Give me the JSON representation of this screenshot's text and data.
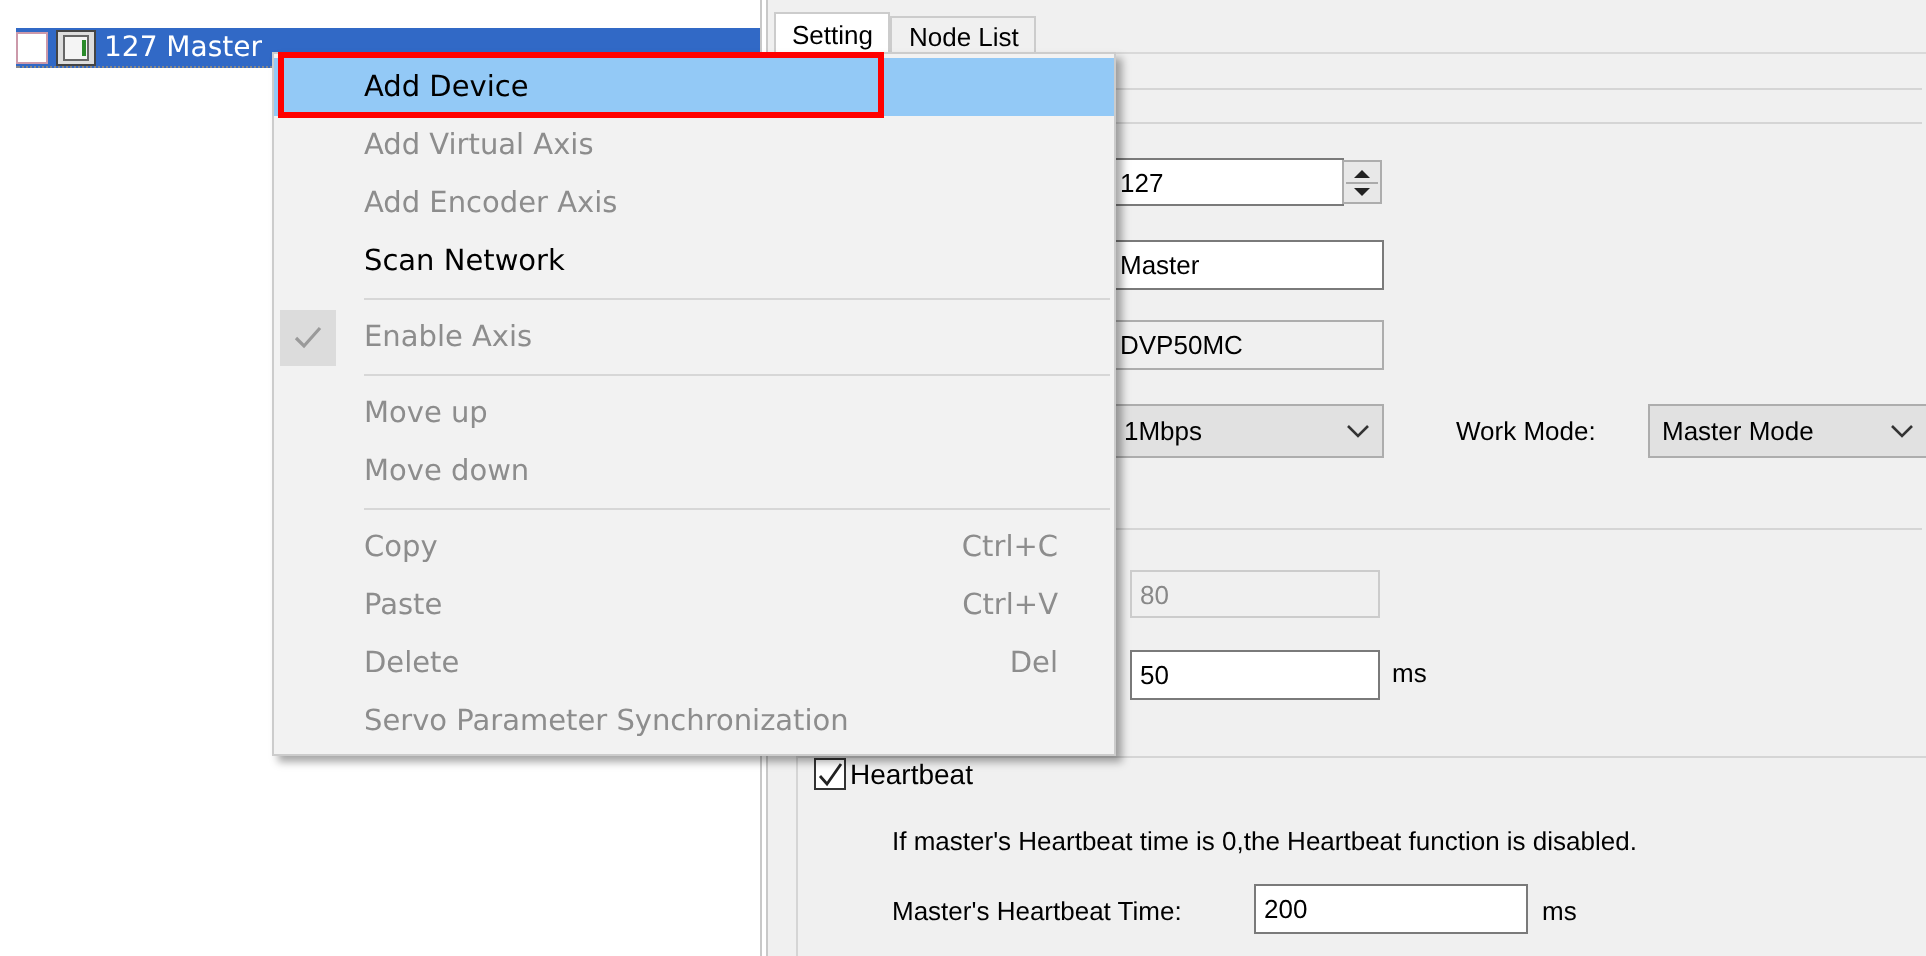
{
  "tree": {
    "items": [
      {
        "label": "127  Master",
        "selected": true,
        "checked": false
      }
    ]
  },
  "tabs": [
    {
      "label": "Setting",
      "selected": true
    },
    {
      "label": "Node List",
      "selected": false
    }
  ],
  "form": {
    "node_id": {
      "value": "127"
    },
    "name": {
      "value": "Master"
    },
    "model": {
      "value": "DVP50MC"
    },
    "baud_rate": {
      "value": "1Mbps"
    },
    "work_mode": {
      "label": "Work Mode:",
      "value": "Master Mode"
    },
    "field_1": {
      "value": "80",
      "disabled": true
    },
    "field_2": {
      "value": "50",
      "unit": "ms",
      "disabled": false
    },
    "heartbeat": {
      "label": "Heartbeat",
      "checked": true,
      "note": "If master's Heartbeat time is 0,the Heartbeat function is disabled.",
      "time_label": "Master's Heartbeat Time:",
      "time_value": "200",
      "unit": "ms"
    }
  },
  "context_menu": {
    "items": [
      {
        "kind": "item",
        "label": "Add Device",
        "disabled": false,
        "selected": true,
        "checked": false,
        "highlighted": true
      },
      {
        "kind": "item",
        "label": "Add Virtual Axis",
        "disabled": true,
        "selected": false,
        "checked": false,
        "highlighted": false
      },
      {
        "kind": "item",
        "label": "Add Encoder Axis",
        "disabled": true,
        "selected": false,
        "checked": false,
        "highlighted": false
      },
      {
        "kind": "item",
        "label": "Scan Network",
        "disabled": false,
        "selected": false,
        "checked": false,
        "highlighted": false
      },
      {
        "kind": "separator"
      },
      {
        "kind": "item",
        "label": "Enable Axis",
        "disabled": true,
        "selected": false,
        "checked": true,
        "highlighted": false
      },
      {
        "kind": "separator"
      },
      {
        "kind": "item",
        "label": "Move up",
        "disabled": true,
        "selected": false,
        "checked": false,
        "highlighted": false
      },
      {
        "kind": "item",
        "label": "Move down",
        "disabled": true,
        "selected": false,
        "checked": false,
        "highlighted": false
      },
      {
        "kind": "separator"
      },
      {
        "kind": "item",
        "label": "Copy",
        "shortcut": "Ctrl+C",
        "disabled": true,
        "selected": false,
        "checked": false,
        "highlighted": false
      },
      {
        "kind": "item",
        "label": "Paste",
        "shortcut": "Ctrl+V",
        "disabled": true,
        "selected": false,
        "checked": false,
        "highlighted": false
      },
      {
        "kind": "item",
        "label": "Delete",
        "shortcut": "Del",
        "disabled": true,
        "selected": false,
        "checked": false,
        "highlighted": false
      },
      {
        "kind": "item",
        "label": "Servo Parameter Synchronization",
        "disabled": true,
        "selected": false,
        "checked": false,
        "highlighted": false
      }
    ]
  }
}
